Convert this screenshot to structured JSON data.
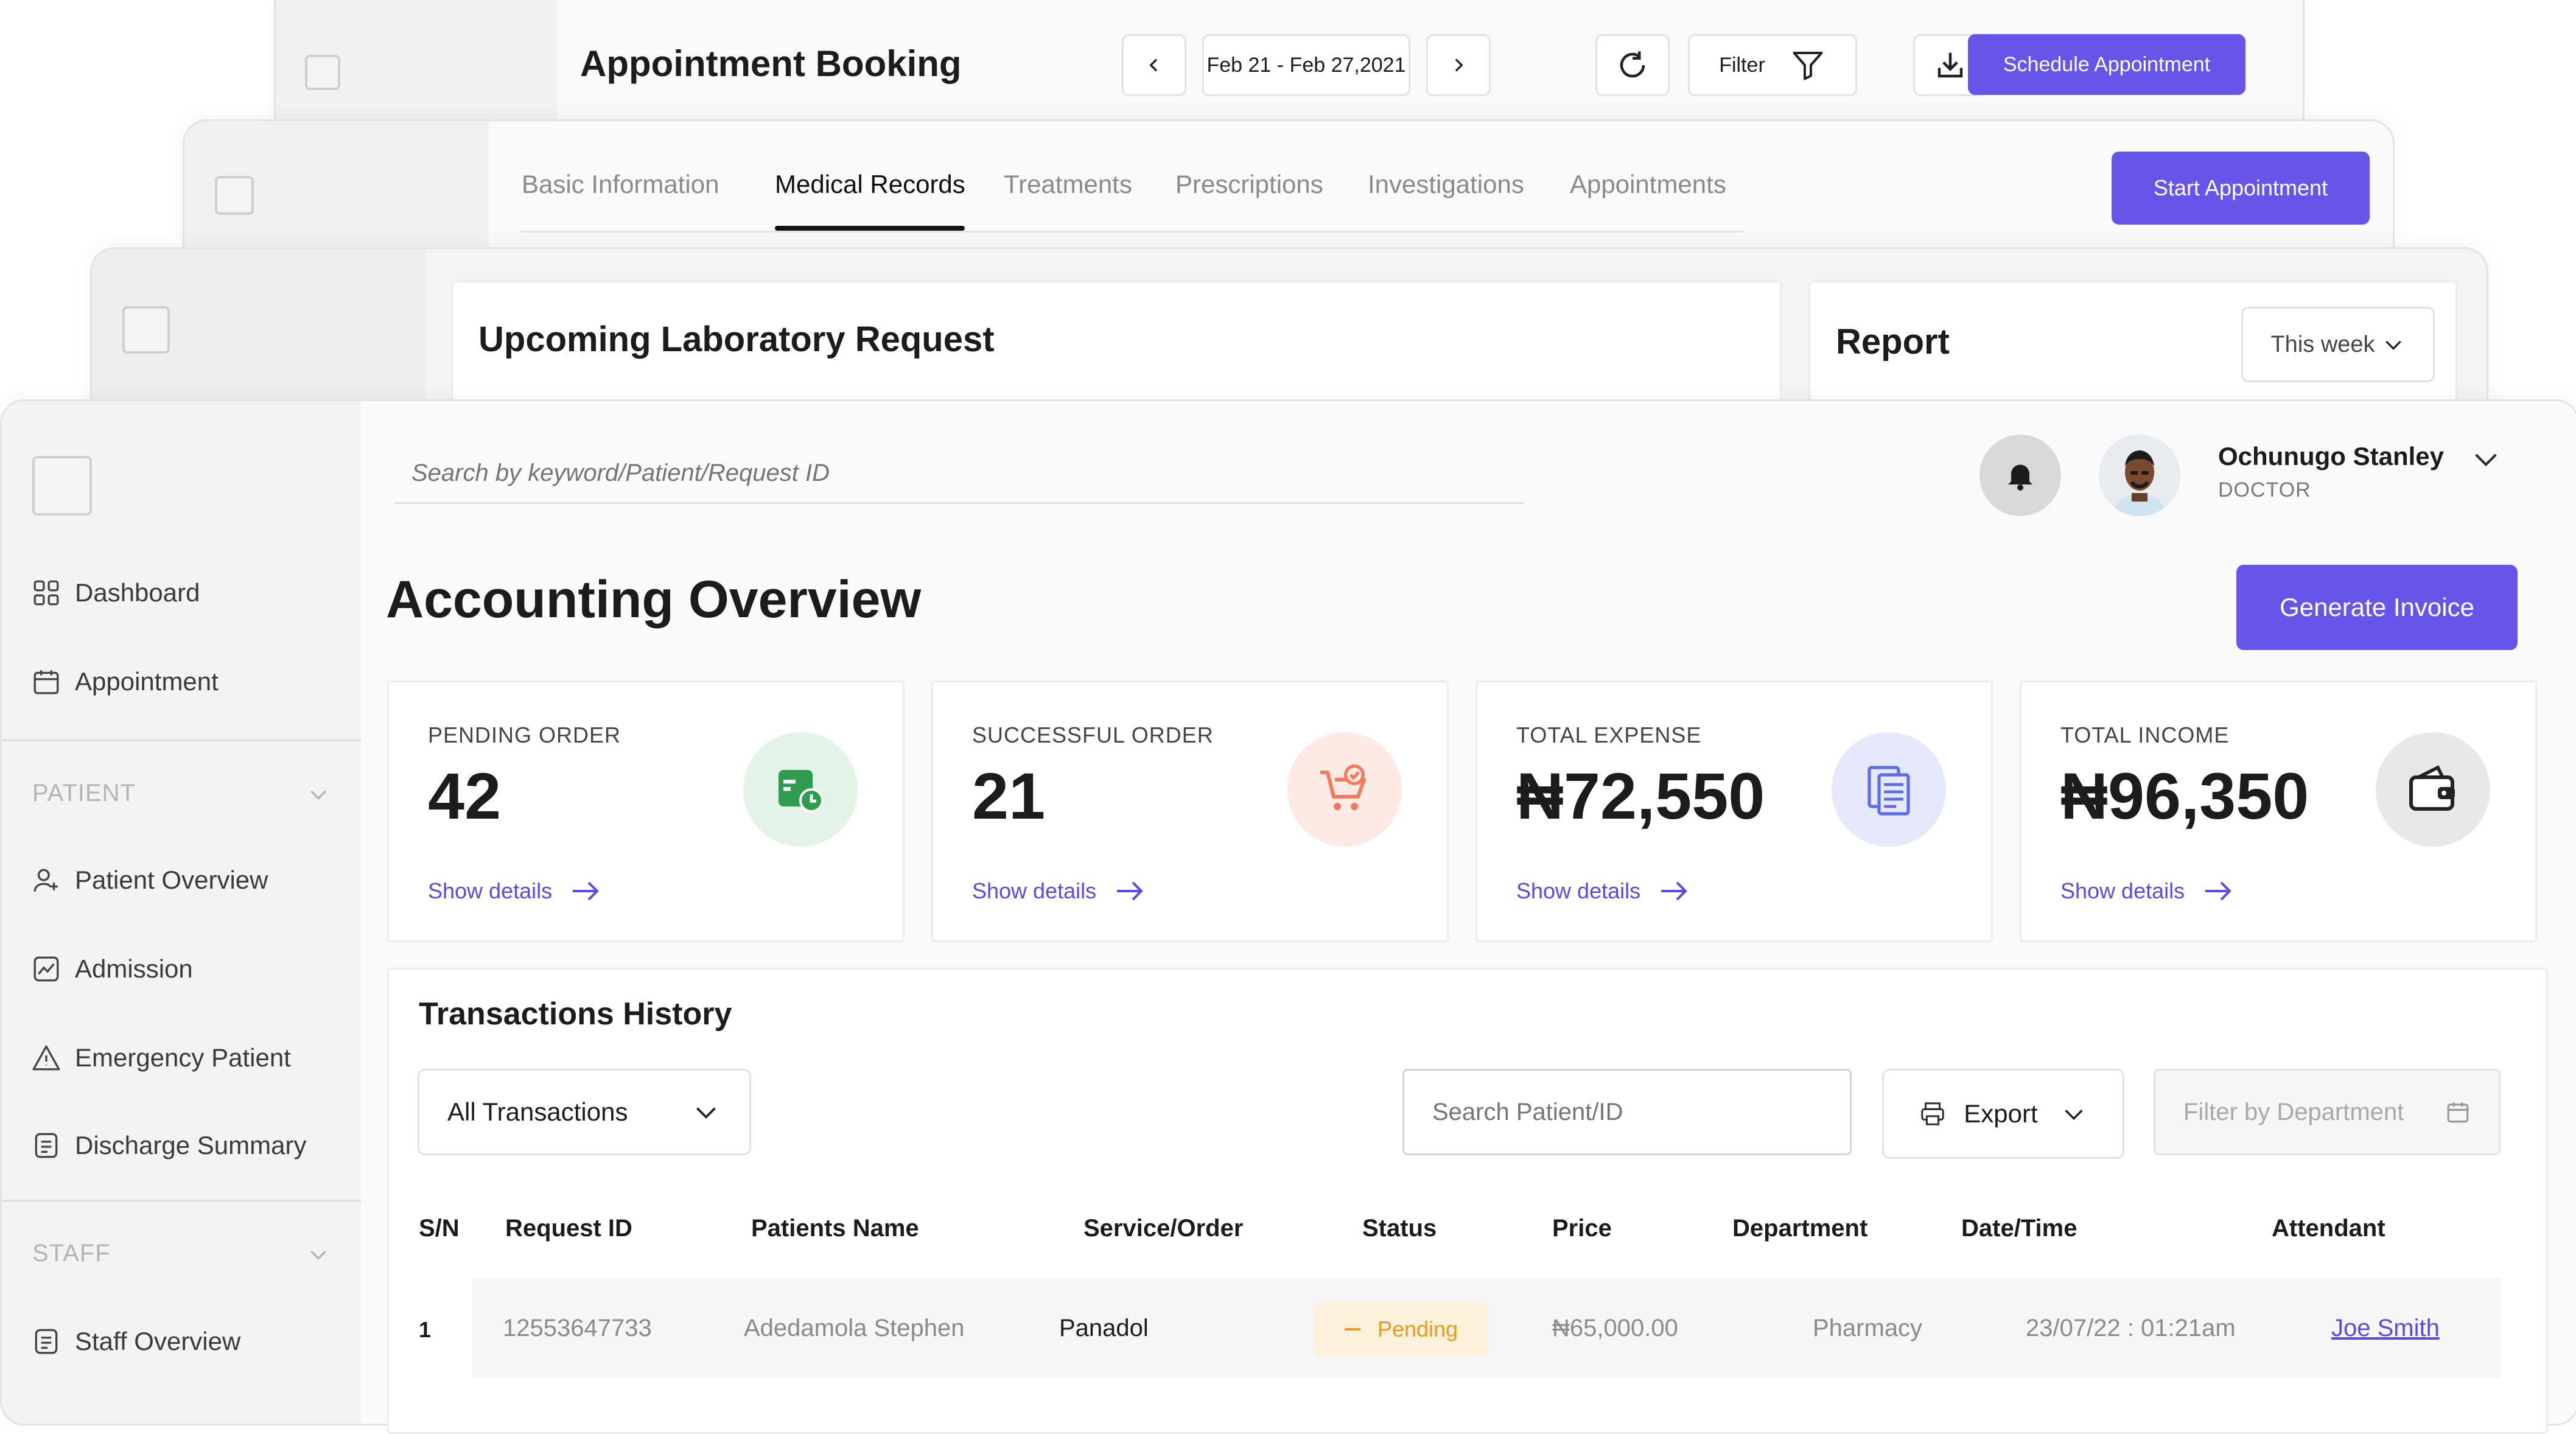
{
  "layer1": {
    "title": "Appointment Booking",
    "date_range": "Feb 21 - Feb 27,2021",
    "filter_label": "Filter",
    "schedule_button": "Schedule Appointment"
  },
  "layer2": {
    "tabs": [
      "Basic Information",
      "Medical Records",
      "Treatments",
      "Prescriptions",
      "Investigations",
      "Appointments"
    ],
    "active_tab": "Medical Records",
    "start_button": "Start Appointment"
  },
  "layer3": {
    "lab_title": "Upcoming Laboratory Request",
    "report_title": "Report",
    "report_period": "This week"
  },
  "topbar": {
    "search_placeholder": "Search by keyword/Patient/Request ID",
    "user_name": "Ochunugo Stanley",
    "user_role": "DOCTOR"
  },
  "sidebar": {
    "items": [
      {
        "label": "Dashboard",
        "icon": "grid-icon"
      },
      {
        "label": "Appointment",
        "icon": "calendar-icon"
      }
    ],
    "patient_section": "PATIENT",
    "patient_items": [
      {
        "label": "Patient Overview",
        "icon": "user-plus-icon"
      },
      {
        "label": "Admission",
        "icon": "chart-icon"
      },
      {
        "label": "Emergency Patient",
        "icon": "warning-icon"
      },
      {
        "label": "Discharge Summary",
        "icon": "document-icon"
      }
    ],
    "staff_section": "STAFF",
    "staff_items": [
      {
        "label": "Staff Overview",
        "icon": "document-icon"
      }
    ]
  },
  "main": {
    "page_title": "Accounting Overview",
    "generate_button": "Generate Invoice",
    "stats": [
      {
        "label": "PENDING ORDER",
        "value": "42",
        "link": "Show details",
        "icon": "pending-calendar-icon",
        "color": "#2e9b4e"
      },
      {
        "label": "SUCCESSFUL ORDER",
        "value": "21",
        "link": "Show details",
        "icon": "cart-check-icon",
        "color": "#f07a5a"
      },
      {
        "label": "TOTAL EXPENSE",
        "value": "₦72,550",
        "link": "Show details",
        "icon": "receipt-icon",
        "color": "#5b6ee8"
      },
      {
        "label": "TOTAL INCOME",
        "value": "₦96,350",
        "link": "Show details",
        "icon": "wallet-icon",
        "color": "#222222"
      }
    ]
  },
  "transactions": {
    "title": "Transactions History",
    "filter_select": "All Transactions",
    "search_placeholder": "Search Patient/ID",
    "export_label": "Export",
    "department_placeholder": "Filter by Department",
    "columns": [
      "S/N",
      "Request ID",
      "Patients Name",
      "Service/Order",
      "Status",
      "Price",
      "Department",
      "Date/Time",
      "Attendant"
    ],
    "rows": [
      {
        "sn": "1",
        "request_id": "12553647733",
        "patient": "Adedamola Stephen",
        "service": "Panadol",
        "status": "Pending",
        "price": "₦65,000.00",
        "department": "Pharmacy",
        "datetime": "23/07/22 : 01:21am",
        "attendant": "Joe Smith"
      }
    ]
  },
  "colors": {
    "accent": "#6655e8",
    "pending_bg": "#fdf1dc",
    "pending_text": "#e89b1c"
  }
}
